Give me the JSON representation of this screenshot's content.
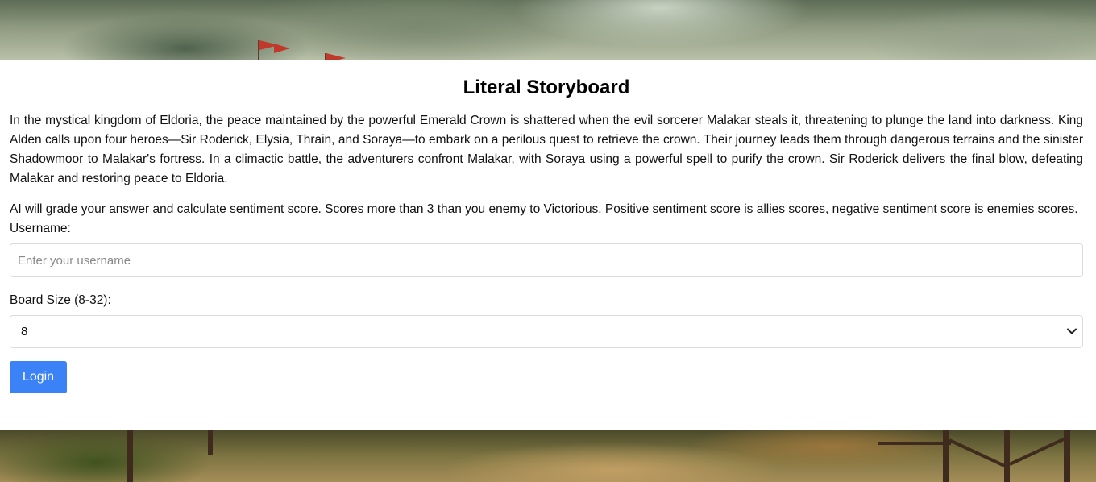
{
  "page": {
    "title": "Literal Storyboard",
    "story": "In the mystical kingdom of Eldoria, the peace maintained by the powerful Emerald Crown is shattered when the evil sorcerer Malakar steals it, threatening to plunge the land into darkness. King Alden calls upon four heroes—Sir Roderick, Elysia, Thrain, and Soraya—to embark on a perilous quest to retrieve the crown. Their journey leads them through dangerous terrains and the sinister Shadowmoor to Malakar's fortress. In a climactic battle, the adventurers confront Malakar, with Soraya using a powerful spell to purify the crown. Sir Roderick delivers the final blow, defeating Malakar and restoring peace to Eldoria.",
    "rules": "AI will grade your answer and calculate sentiment score. Scores more than 3 than you enemy to Victorious. Positive sentiment score is allies scores, negative sentiment score is enemies scores."
  },
  "form": {
    "username_label": "Username:",
    "username_placeholder": "Enter your username",
    "username_value": "",
    "board_size_label": "Board Size (8-32):",
    "board_size_value": "8",
    "login_label": "Login"
  },
  "colors": {
    "button": "#3b82f6",
    "flag": "#c0392b"
  },
  "icons": {
    "select_chevron": "chevron-down-icon"
  }
}
